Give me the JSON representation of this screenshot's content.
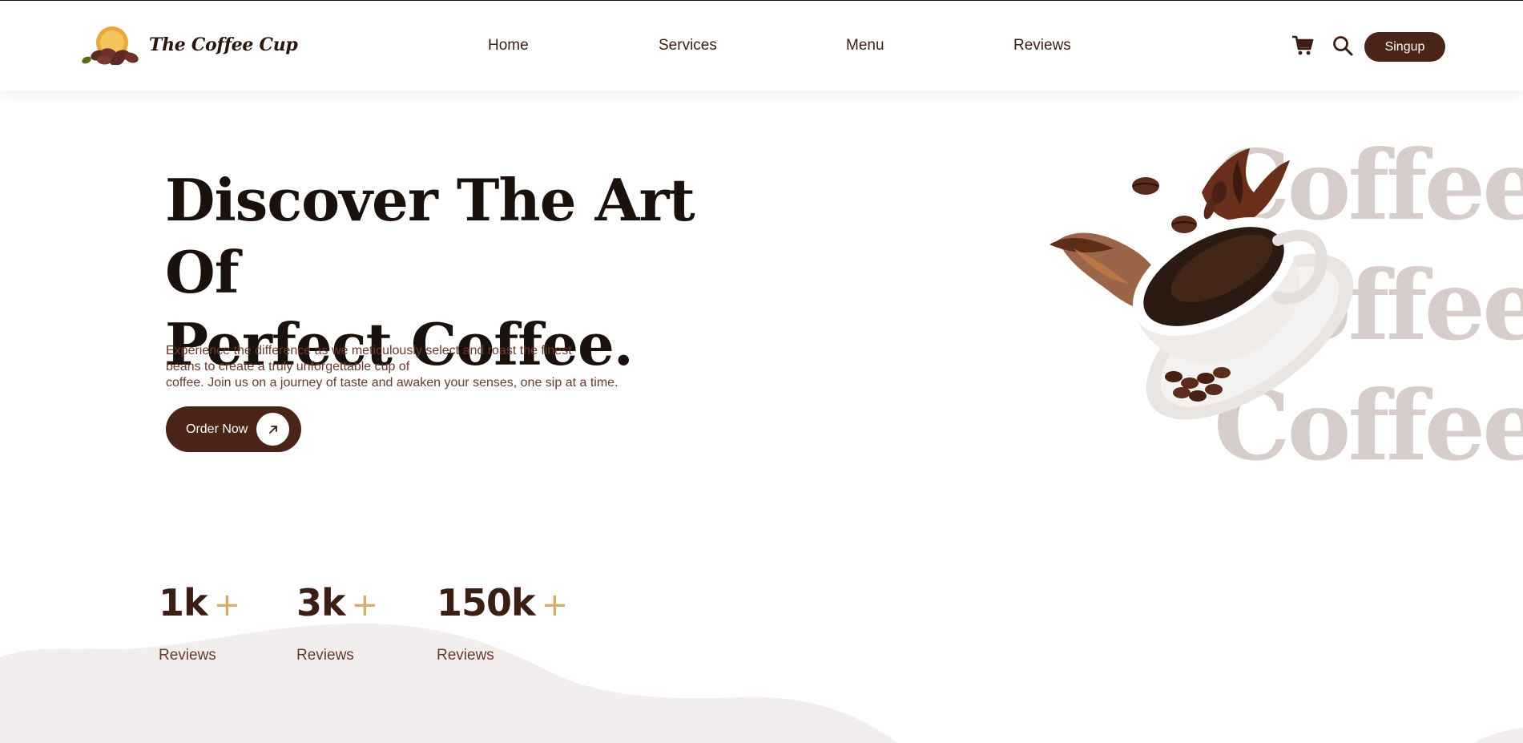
{
  "brand": {
    "name": "The Coffee Cup"
  },
  "nav": {
    "items": [
      {
        "label": "Home"
      },
      {
        "label": "Services"
      },
      {
        "label": "Menu"
      },
      {
        "label": "Reviews"
      }
    ]
  },
  "header_actions": {
    "cart_icon": "cart-icon",
    "search_icon": "search-icon",
    "signup_label": "Singup"
  },
  "hero": {
    "title_line1": "Discover The Art Of",
    "title_line2": "Perfect Coffee.",
    "description_lines": [
      "Experience the difference as we meticulously select and roast the finest",
      "beans to create a truly unforgettable cup of",
      "coffee. Join us on a journey of taste and awaken your senses, one sip at a time."
    ],
    "cta_label": "Order Now",
    "cta_icon": "arrow-up-right-icon",
    "background_words": [
      "Coffee",
      "Coffee",
      "Coffee"
    ]
  },
  "stats": [
    {
      "value": "1k",
      "suffix": "+",
      "label": "Reviews"
    },
    {
      "value": "3k",
      "suffix": "+",
      "label": "Reviews"
    },
    {
      "value": "150k",
      "suffix": "+",
      "label": "Reviews"
    }
  ],
  "colors": {
    "primary": "#4a2417",
    "heading": "#1a110c",
    "accent": "#d4ad6b",
    "muted_text": "#6b3a2a",
    "background_word": "#d7cdca",
    "wave": "#f2eeee"
  }
}
